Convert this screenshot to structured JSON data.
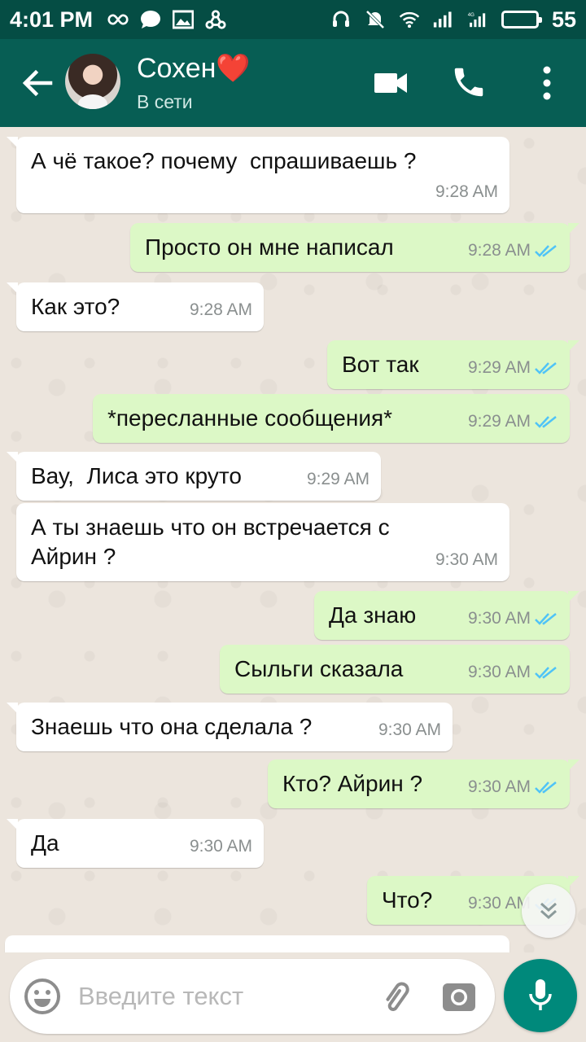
{
  "status_bar": {
    "time": "4:01 PM",
    "battery_level": "55",
    "battery_fraction": 0.55,
    "left_icons": [
      "infinity-icon",
      "chat-bubble-icon",
      "image-icon",
      "share-icon"
    ],
    "right_icons": [
      "headset-icon",
      "mute-icon",
      "wifi-icon",
      "signal-icon",
      "signal-4g-icon",
      "battery-icon"
    ]
  },
  "header": {
    "contact_name": "Сохен❤️",
    "status": "В сети",
    "back_icon": "arrow-left-icon",
    "video_icon": "video-call-icon",
    "call_icon": "phone-icon",
    "menu_icon": "more-vert-icon",
    "color": "#075e54"
  },
  "messages": [
    {
      "dir": "in",
      "text": "А чё такое? почему  спрашиваешь ?",
      "time": "9:28 AM"
    },
    {
      "dir": "out",
      "text": "Просто он мне написал",
      "time": "9:28 AM",
      "read": true
    },
    {
      "dir": "in",
      "text": "Как это?",
      "time": "9:28 AM"
    },
    {
      "dir": "out",
      "text": "Вот так",
      "time": "9:29 AM",
      "read": true
    },
    {
      "dir": "out",
      "text": "*пересланные сообщения*",
      "time": "9:29 AM",
      "read": true
    },
    {
      "dir": "in",
      "text": "Вау,  Лиса это круто",
      "time": "9:29 AM"
    },
    {
      "dir": "in",
      "text": "А ты знаешь что он встречается с\nАйрин ?",
      "time": "9:30 AM"
    },
    {
      "dir": "out",
      "text": "Да знаю",
      "time": "9:30 AM",
      "read": true
    },
    {
      "dir": "out",
      "text": "Сыльги сказала",
      "time": "9:30 AM",
      "read": true
    },
    {
      "dir": "in",
      "text": "Знаешь что она сделала ?",
      "time": "9:30 AM"
    },
    {
      "dir": "out",
      "text": "Кто? Айрин ?",
      "time": "9:30 AM",
      "read": true
    },
    {
      "dir": "in",
      "text": "Да",
      "time": "9:30 AM"
    },
    {
      "dir": "out",
      "text": "Что?",
      "time": "9:30 AM",
      "read": true
    }
  ],
  "composer": {
    "placeholder": "Введите текст",
    "emoji_icon": "emoji-icon",
    "attach_icon": "paperclip-icon",
    "camera_icon": "camera-icon",
    "mic_icon": "mic-icon",
    "accent": "#00897b"
  },
  "colors": {
    "incoming_bubble": "#ffffff",
    "outgoing_bubble": "#dcf8c6",
    "read_tick": "#4fc3f7"
  }
}
